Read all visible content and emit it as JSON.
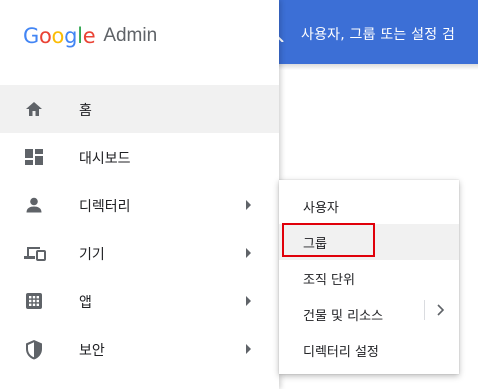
{
  "header": {
    "search_text": "사용자, 그룹 또는 설정 검",
    "bar_color": "#3c6fd6"
  },
  "logo": {
    "brand_letters": [
      "G",
      "o",
      "o",
      "g",
      "l",
      "e"
    ],
    "product": "Admin"
  },
  "sidebar": {
    "items": [
      {
        "label": "홈",
        "icon": "home-icon",
        "active": true,
        "has_submenu": false
      },
      {
        "label": "대시보드",
        "icon": "dashboard-icon",
        "active": false,
        "has_submenu": false
      },
      {
        "label": "디렉터리",
        "icon": "person-icon",
        "active": false,
        "has_submenu": true
      },
      {
        "label": "기기",
        "icon": "devices-icon",
        "active": false,
        "has_submenu": true
      },
      {
        "label": "앱",
        "icon": "apps-grid-icon",
        "active": false,
        "has_submenu": true
      },
      {
        "label": "보안",
        "icon": "shield-icon",
        "active": false,
        "has_submenu": true
      }
    ]
  },
  "flyout": {
    "parent": "디렉터리",
    "items": [
      {
        "label": "사용자"
      },
      {
        "label": "그룹",
        "highlighted": true
      },
      {
        "label": "조직 단위"
      },
      {
        "label": "건물 및 리소스",
        "has_submenu": true
      },
      {
        "label": "디렉터리 설정"
      }
    ]
  },
  "annotation": {
    "highlight_color": "#e0000a",
    "target": "그룹"
  }
}
